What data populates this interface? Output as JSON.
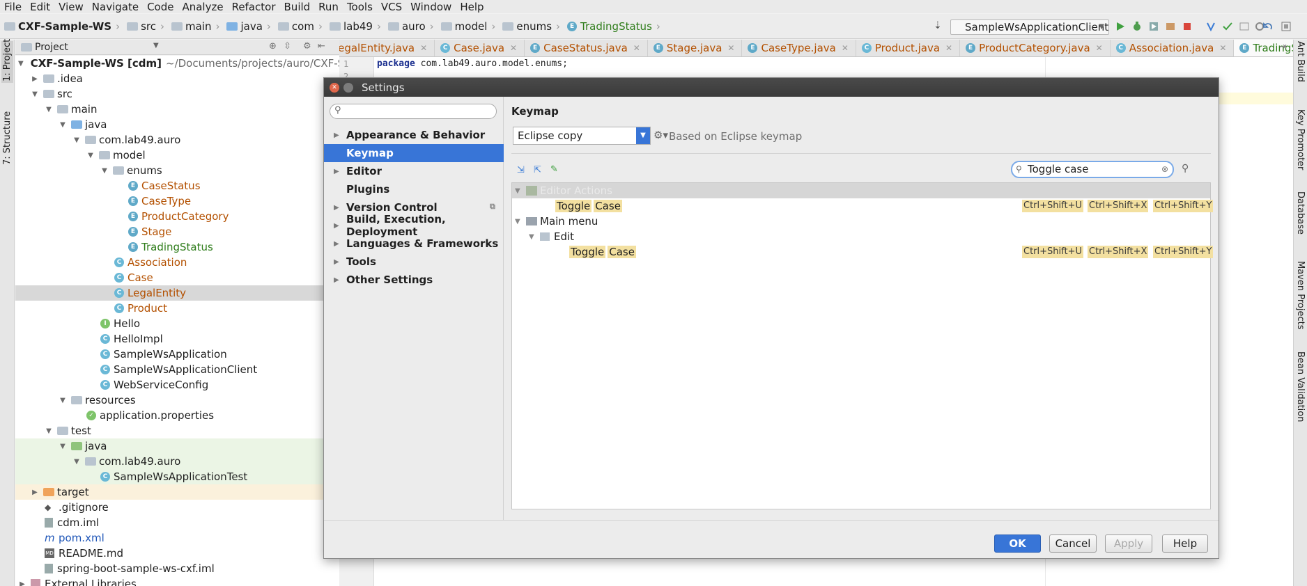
{
  "menubar": [
    "File",
    "Edit",
    "View",
    "Navigate",
    "Code",
    "Analyze",
    "Refactor",
    "Build",
    "Run",
    "Tools",
    "VCS",
    "Window",
    "Help"
  ],
  "breadcrumb": [
    "CXF-Sample-WS",
    "src",
    "main",
    "java",
    "com",
    "lab49",
    "auro",
    "model",
    "enums",
    "TradingStatus"
  ],
  "run_config": "SampleWsApplicationClient",
  "left_strip": {
    "project": "1: Project",
    "structure": "7: Structure"
  },
  "right_strip": {
    "ant": "Ant Build",
    "key": "Key Promoter",
    "database": "Database",
    "maven": "Maven Projects",
    "bean": "Bean Validation"
  },
  "project_panel": {
    "title": "Project",
    "root_name": "CXF-Sample-WS [cdm]",
    "root_path": "~/Documents/projects/auro/CXF-Samp",
    "items": [
      ".idea",
      "src",
      "main",
      "java",
      "com.lab49.auro",
      "model",
      "enums",
      "CaseStatus",
      "CaseType",
      "ProductCategory",
      "Stage",
      "TradingStatus",
      "Association",
      "Case",
      "LegalEntity",
      "Product",
      "Hello",
      "HelloImpl",
      "SampleWsApplication",
      "SampleWsApplicationClient",
      "WebServiceConfig",
      "resources",
      "application.properties",
      "test",
      "java",
      "com.lab49.auro",
      "SampleWsApplicationTest",
      "target",
      ".gitignore",
      "cdm.iml",
      "pom.xml",
      "README.md",
      "spring-boot-sample-ws-cxf.iml",
      "External Libraries"
    ]
  },
  "tabs": [
    "LegalEntity.java",
    "Case.java",
    "CaseStatus.java",
    "Stage.java",
    "CaseType.java",
    "Product.java",
    "ProductCategory.java",
    "Association.java",
    "TradingStatus.java"
  ],
  "editor": {
    "line1_num": "1",
    "line2_num": "2",
    "line1_keyword": "package",
    "line1_rest": " com.lab49.auro.model.enums;"
  },
  "dialog": {
    "title": "Settings",
    "search_value": "",
    "nav": [
      "Appearance & Behavior",
      "Keymap",
      "Editor",
      "Plugins",
      "Version Control",
      "Build, Execution, Deployment",
      "Languages & Frameworks",
      "Tools",
      "Other Settings"
    ],
    "keymap_title": "Keymap",
    "keymap_selected": "Eclipse copy",
    "based_on": "Based on Eclipse keymap",
    "search_text": "Toggle case",
    "rows": {
      "editor_actions": "Editor Actions",
      "toggle_case_1_a": "Toggle",
      "toggle_case_1_b": "Case",
      "main_menu": "Main menu",
      "edit": "Edit",
      "toggle_case_2_a": "Toggle",
      "toggle_case_2_b": "Case"
    },
    "shortcuts": [
      "Ctrl+Shift+U",
      "Ctrl+Shift+X",
      "Ctrl+Shift+Y"
    ],
    "buttons": {
      "ok": "OK",
      "cancel": "Cancel",
      "apply": "Apply",
      "help": "Help"
    }
  },
  "colors": {
    "accent": "#3875d7",
    "highlight": "#f3e0a0",
    "orange_label": "#b35000",
    "green_label": "#2f7d1b"
  }
}
